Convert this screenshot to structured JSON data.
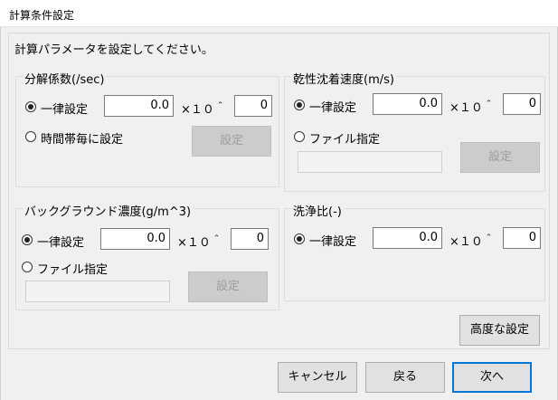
{
  "window": {
    "title": "計算条件設定"
  },
  "instruction": "計算パラメータを設定してください。",
  "decomposition": {
    "title": "分解係数(/sec)",
    "uniform_label": "一律設定",
    "value": "0.0",
    "mult": "×１０＾",
    "exponent": "0",
    "alt_label": "時間帯毎に設定",
    "set_button": "設定"
  },
  "dry_deposition": {
    "title": "乾性沈着速度(m/s)",
    "uniform_label": "一律設定",
    "value": "0.0",
    "mult": "×１０＾",
    "exponent": "0",
    "alt_label": "ファイル指定",
    "file_path": "",
    "set_button": "設定"
  },
  "background": {
    "title": "バックグラウンド濃度(g/m^3)",
    "uniform_label": "一律設定",
    "value": "0.0",
    "mult": "×１０＾",
    "exponent": "0",
    "alt_label": "ファイル指定",
    "file_path": "",
    "set_button": "設定"
  },
  "washout": {
    "title": "洗浄比(-)",
    "uniform_label": "一律設定",
    "value": "0.0",
    "mult": "×１０＾",
    "exponent": "0"
  },
  "advanced_button": "高度な設定",
  "footer": {
    "cancel": "キャンセル",
    "back": "戻る",
    "next": "次へ"
  }
}
